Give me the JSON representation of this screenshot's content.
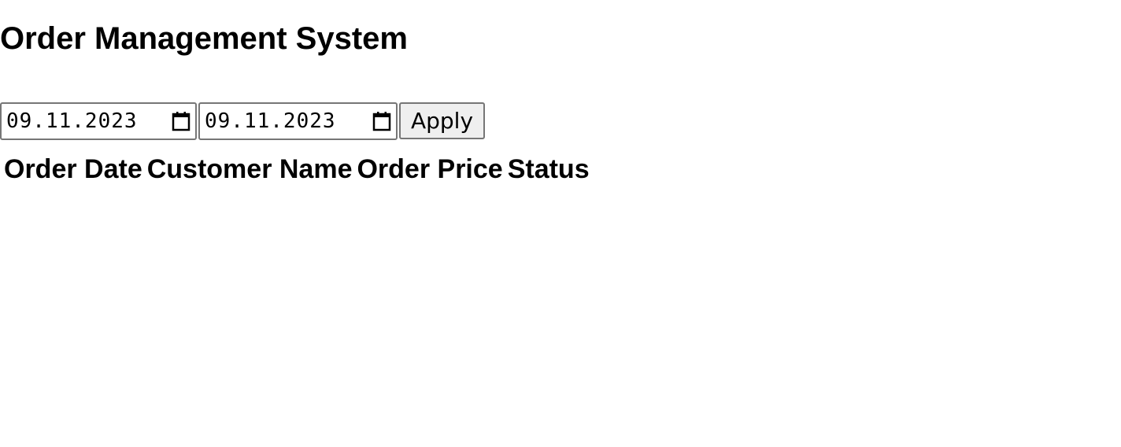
{
  "page": {
    "title": "Order Management System"
  },
  "filters": {
    "start_date": "09.11.2023",
    "end_date": "09.11.2023",
    "apply_label": "Apply"
  },
  "icons": {
    "date_picker": "calendar-icon"
  },
  "table": {
    "headers": [
      "Order Date",
      "Customer Name",
      "Order Price",
      "Status"
    ],
    "rows": []
  }
}
